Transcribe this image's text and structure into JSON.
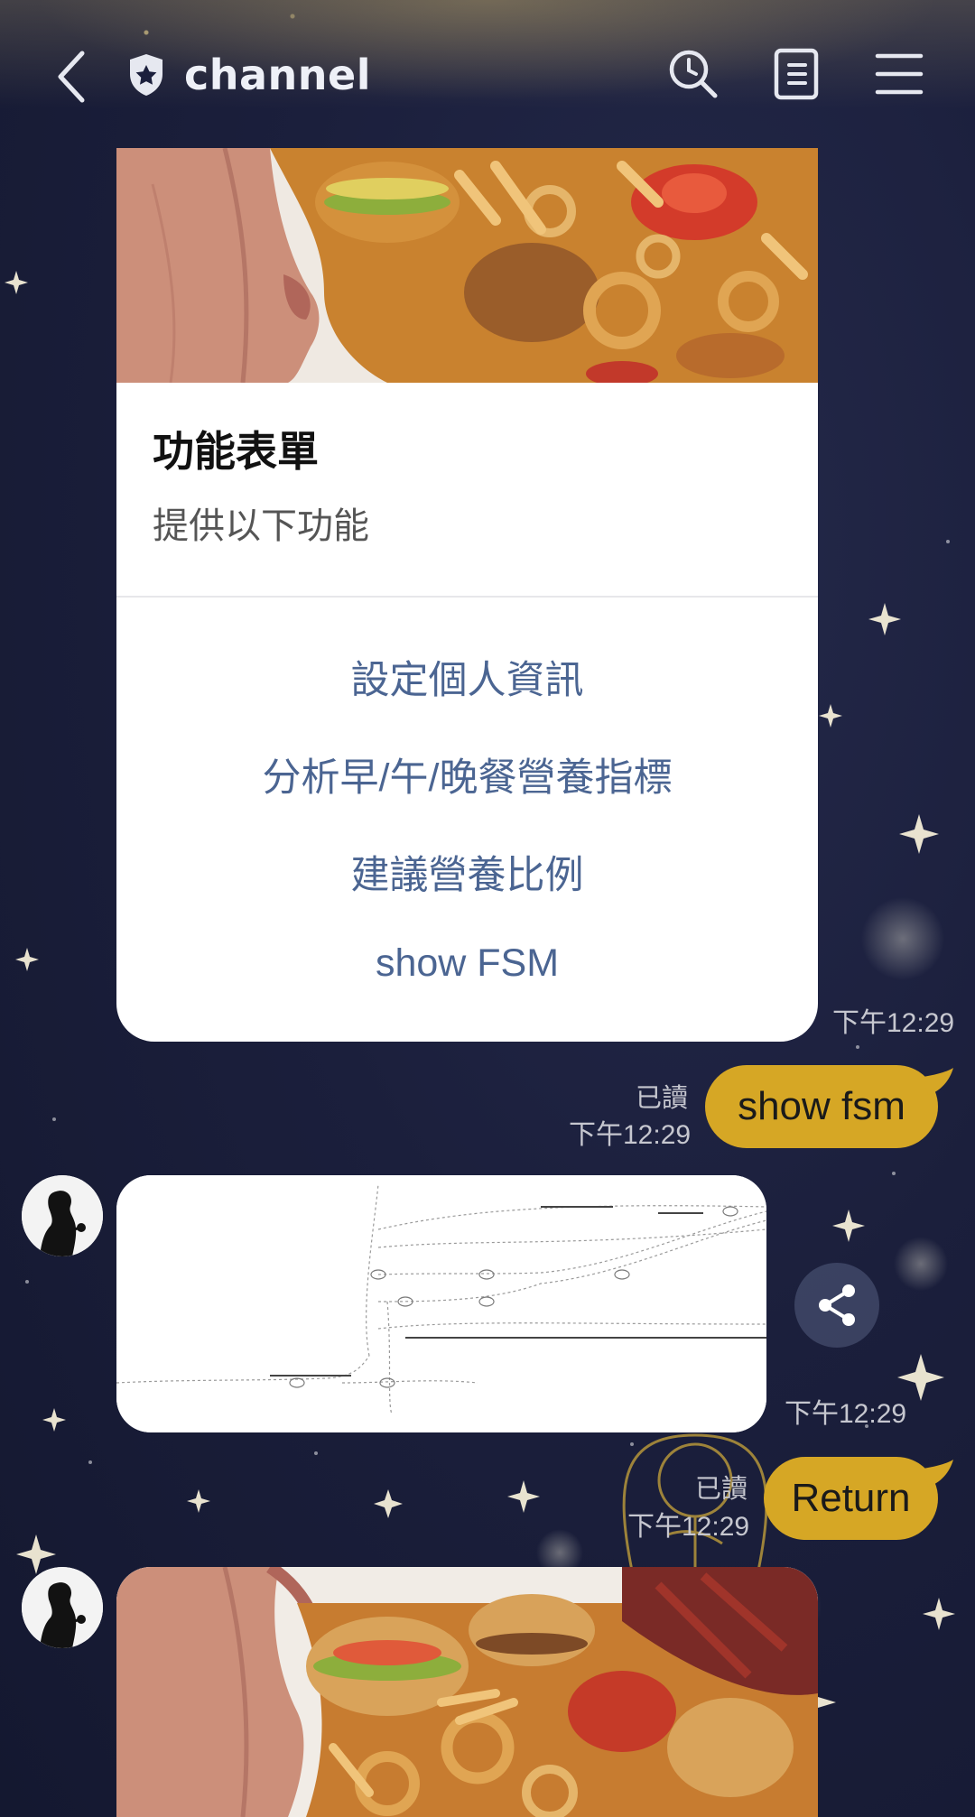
{
  "header": {
    "title": "channel",
    "back_icon": "chevron-left-icon",
    "shield_icon": "shield-star-icon",
    "search_icon": "search-icon",
    "notes_icon": "notes-icon",
    "menu_icon": "menu-icon"
  },
  "menu_card": {
    "title": "功能表單",
    "subtitle": "提供以下功能",
    "actions": [
      "設定個人資訊",
      "分析早/午/晚餐營養指標",
      "建議營養比例",
      "show FSM"
    ],
    "timestamp": "下午12:29"
  },
  "messages": {
    "user_1": {
      "text": "show fsm",
      "read": "已讀",
      "time": "下午12:29"
    },
    "bot_image_time": "下午12:29",
    "user_2": {
      "text": "Return",
      "read": "已讀",
      "time": "下午12:29"
    }
  },
  "colors": {
    "accent_bubble": "#d6a725",
    "action_text": "#4b6592",
    "background": "#1b1f3c"
  }
}
